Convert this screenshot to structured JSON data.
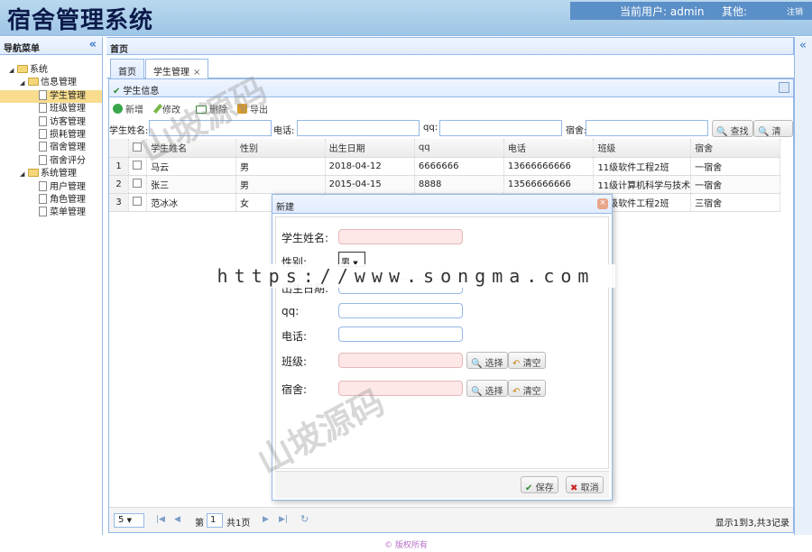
{
  "header": {
    "title": "宿舍管理系统",
    "current_user": "当前用户: admin",
    "other": "其他:",
    "logout": "注销"
  },
  "nav": {
    "title": "导航菜单",
    "collapse": "«",
    "tree": [
      {
        "label": "系统",
        "level": 0,
        "type": "folder"
      },
      {
        "label": "信息管理",
        "level": 1,
        "type": "folder"
      },
      {
        "label": "学生管理",
        "level": 2,
        "type": "file",
        "selected": true
      },
      {
        "label": "班级管理",
        "level": 2,
        "type": "file"
      },
      {
        "label": "访客管理",
        "level": 2,
        "type": "file"
      },
      {
        "label": "损耗管理",
        "level": 2,
        "type": "file"
      },
      {
        "label": "宿舍管理",
        "level": 2,
        "type": "file"
      },
      {
        "label": "宿舍评分",
        "level": 2,
        "type": "file"
      },
      {
        "label": "系统管理",
        "level": 1,
        "type": "folder"
      },
      {
        "label": "用户管理",
        "level": 2,
        "type": "file"
      },
      {
        "label": "角色管理",
        "level": 2,
        "type": "file"
      },
      {
        "label": "菜单管理",
        "level": 2,
        "type": "file"
      }
    ]
  },
  "main": {
    "title": "首页",
    "tabs": [
      {
        "label": "首页"
      },
      {
        "label": "学生管理",
        "close": "×"
      }
    ],
    "panel_title": "学生信息",
    "toolbar": {
      "add": "新增",
      "edit": "修改",
      "delete": "删除",
      "export": "导出"
    },
    "search": {
      "name_label": "学生姓名:",
      "phone_label": "电话:",
      "qq_label": "qq:",
      "dorm_label": "宿舍:",
      "search_btn": "查找",
      "clear_btn": "清空"
    },
    "grid": {
      "columns": [
        "学生姓名",
        "性别",
        "出生日期",
        "qq",
        "电话",
        "班级",
        "宿舍"
      ],
      "rows": [
        {
          "n": "1",
          "cells": [
            "马云",
            "男",
            "2018-04-12",
            "6666666",
            "13666666666",
            "11级软件工程2班",
            "一宿舍"
          ]
        },
        {
          "n": "2",
          "cells": [
            "张三",
            "男",
            "2015-04-15",
            "8888",
            "13566666666",
            "11级计算机科学与技术",
            "一宿舍"
          ]
        },
        {
          "n": "3",
          "cells": [
            "范冰冰",
            "女",
            "",
            "",
            "",
            "11级软件工程2班",
            "三宿舍"
          ]
        }
      ]
    },
    "pager": {
      "page_size": "5",
      "page_prefix": "第",
      "page_value": "1",
      "page_suffix": "共1页",
      "info": "显示1到3,共3记录"
    }
  },
  "dialog": {
    "title": "新建",
    "close": "×",
    "fields": {
      "name_label": "学生姓名:",
      "gender_label": "性别:",
      "gender_value": "男",
      "birth_label": "出生日期:",
      "qq_label": "qq:",
      "phone_label": "电话:",
      "class_label": "班级:",
      "dorm_label": "宿舍:"
    },
    "select_btn": "选择",
    "clear_btn": "清空",
    "save": "保存",
    "cancel": "取消"
  },
  "footer": {
    "copyright": "© 版权所有"
  },
  "watermark": {
    "banner": "https://www.songma.com",
    "logo": "山坡源码"
  }
}
